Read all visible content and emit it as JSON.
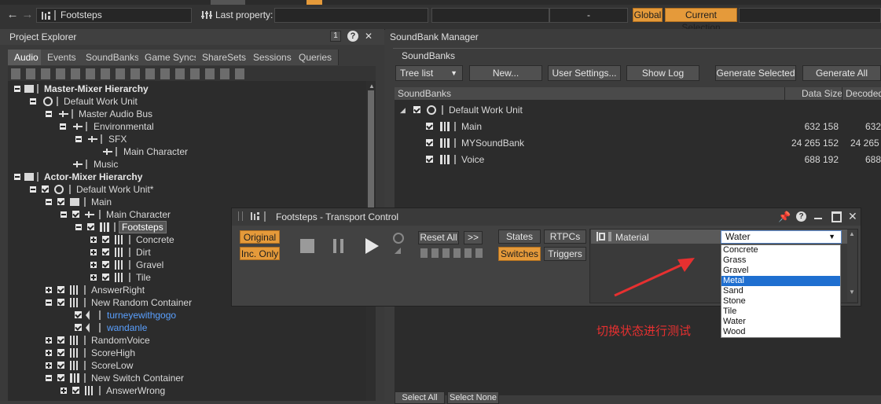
{
  "toolbar": {
    "object_name": "Footsteps",
    "last_property_label": "Last property:",
    "dash_value": "-",
    "global_label": "Global",
    "current_selection_label": "Current Selection"
  },
  "project_explorer": {
    "title": "Project Explorer",
    "tabs": [
      "Audio",
      "Events",
      "SoundBanks",
      "Game Syncs",
      "ShareSets",
      "Sessions",
      "Queries"
    ],
    "tree": {
      "master_mixer": "Master-Mixer Hierarchy",
      "default_work_unit": "Default Work Unit",
      "master_audio_bus": "Master Audio Bus",
      "environmental": "Environmental",
      "sfx": "SFX",
      "main_character_bus": "Main Character",
      "music": "Music",
      "actor_mixer": "Actor-Mixer Hierarchy",
      "default_work_unit_star": "Default Work Unit*",
      "main": "Main",
      "main_character": "Main Character",
      "footsteps": "Footsteps",
      "concrete": "Concrete",
      "dirt": "Dirt",
      "gravel": "Gravel",
      "tile": "Tile",
      "answer_right": "AnswerRight",
      "new_random_container": "New Random Container",
      "turneyewithgogo": "turneyewithgogo",
      "wandanle": "wandanle",
      "random_voice": "RandomVoice",
      "score_high": "ScoreHigh",
      "score_low": "ScoreLow",
      "new_switch_container": "New Switch Container",
      "answer_wrong": "AnswerWrong"
    }
  },
  "soundbank_manager": {
    "title": "SoundBank Manager",
    "section": "SoundBanks",
    "tree_list": "Tree list",
    "new_btn": "New...",
    "user_settings_btn": "User Settings...",
    "show_log_btn": "Show Log",
    "generate_selected_btn": "Generate Selected",
    "generate_all_btn": "Generate All",
    "col_soundbanks": "SoundBanks",
    "col_data_size": "Data Size",
    "col_decoded": "Decoded",
    "work_unit": "Default Work Unit",
    "banks": [
      {
        "name": "Main",
        "size": "632 158",
        "decoded": "632"
      },
      {
        "name": "MYSoundBank",
        "size": "24 265 152",
        "decoded": "24 265"
      },
      {
        "name": "Voice",
        "size": "688 192",
        "decoded": "688"
      }
    ],
    "select_all": "Select All",
    "select_none": "Select None"
  },
  "transport": {
    "title": "Footsteps - Transport Control",
    "original": "Original",
    "inc_only": "Inc. Only",
    "reset_all": "Reset All",
    "more": ">>",
    "states": "States",
    "rtpcs": "RTPCs",
    "switches": "Switches",
    "triggers": "Triggers",
    "material_label": "Material",
    "selected_value": "Water"
  },
  "dropdown_options": [
    "Concrete",
    "Grass",
    "Gravel",
    "Metal",
    "Sand",
    "Stone",
    "Tile",
    "Water",
    "Wood"
  ],
  "annotation": "切换状态进行测试",
  "colors": {
    "accent_orange": "#e59a3a",
    "highlight_blue": "#1f6fd0",
    "annotation_red": "#e63030"
  }
}
